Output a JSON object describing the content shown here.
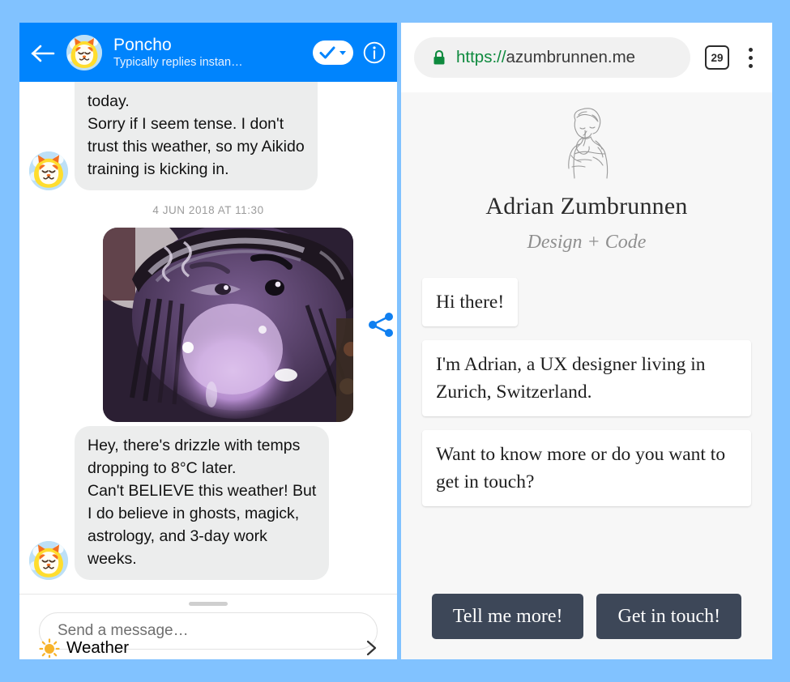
{
  "colors": {
    "page_background": "#81c2ff",
    "messenger_header": "#0084fd",
    "bubble_grey": "#eceded",
    "site_background": "#f7f7f7",
    "site_button": "#3d4758",
    "lock_green": "#0e8a3e",
    "share_blue": "#0f7ff0"
  },
  "left_phone": {
    "header": {
      "back_icon": "back-arrow-icon",
      "avatar_icon": "poncho-avatar",
      "title": "Poncho",
      "subtitle": "Typically replies instan…",
      "check_badge_icon": "checkmark-dropdown-badge",
      "info_icon": "info-circle-icon"
    },
    "thread": {
      "messages": [
        {
          "id": "msg-1",
          "type": "text",
          "clipped": true,
          "text": "today.\nSorry if I seem tense. I don't\ntrust this weather, so my Aikido\ntraining is kicking in."
        },
        {
          "id": "timestamp-1",
          "type": "timestamp",
          "text": "4 JUN 2018 AT 11:30"
        },
        {
          "id": "msg-2",
          "type": "photo",
          "alt": "purple-toned portrait photo",
          "share_icon": "share-icon"
        },
        {
          "id": "msg-3",
          "type": "text",
          "clipped": false,
          "text": "Hey, there's drizzle with temps\ndropping to 8°C later.\nCan't BELIEVE this weather! But\nI do believe in ghosts, magick,\nastrology, and 3-day work\nweeks."
        }
      ]
    },
    "composer": {
      "grabber_icon": "drag-handle",
      "input_placeholder": "Send a message…",
      "input_value": ""
    },
    "quick_reply": {
      "icon": "sun-icon",
      "label": "Weather",
      "chevron_icon": "chevron-right-icon"
    }
  },
  "right_phone": {
    "browser": {
      "lock_icon": "lock-icon",
      "url_scheme": "https://",
      "url_host": "azumbrunnen.me",
      "tab_count": "29",
      "menu_icon": "kebab-menu-icon"
    },
    "site": {
      "illustration_icon": "thinking-person-illustration",
      "name": "Adrian Zumbrunnen",
      "tagline": "Design + Code",
      "bubbles": [
        "Hi there!",
        "I'm Adrian, a UX designer living in Zurich, Switzerland.",
        "Want to know more or do you want to get in touch?"
      ],
      "buttons": [
        "Tell me more!",
        "Get in touch!"
      ]
    }
  }
}
